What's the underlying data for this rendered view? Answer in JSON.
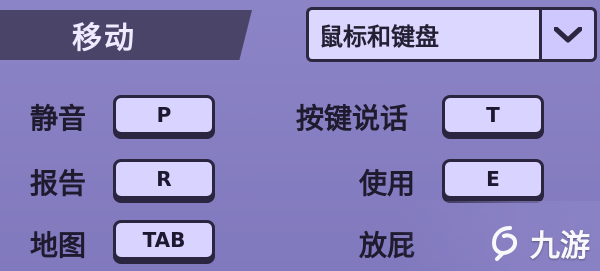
{
  "section": {
    "title": "移动"
  },
  "input_mode": {
    "selected": "鼠标和键盘",
    "icon": "chevron-down-icon"
  },
  "bindings": {
    "mute": {
      "label": "静音",
      "key": "P"
    },
    "report": {
      "label": "报告",
      "key": "R"
    },
    "map": {
      "label": "地图",
      "key": "TAB"
    },
    "push_to_talk": {
      "label": "按键说话",
      "key": "T"
    },
    "use": {
      "label": "使用",
      "key": "E"
    },
    "fart": {
      "label": "放屁"
    }
  },
  "watermark": {
    "text": "九游",
    "icon": "jiuyou-logo-icon"
  },
  "colors": {
    "background": "#8a82c2",
    "header_bar": "#4a4468",
    "key_face": "#d9d3ff",
    "outline": "#2b2540"
  }
}
